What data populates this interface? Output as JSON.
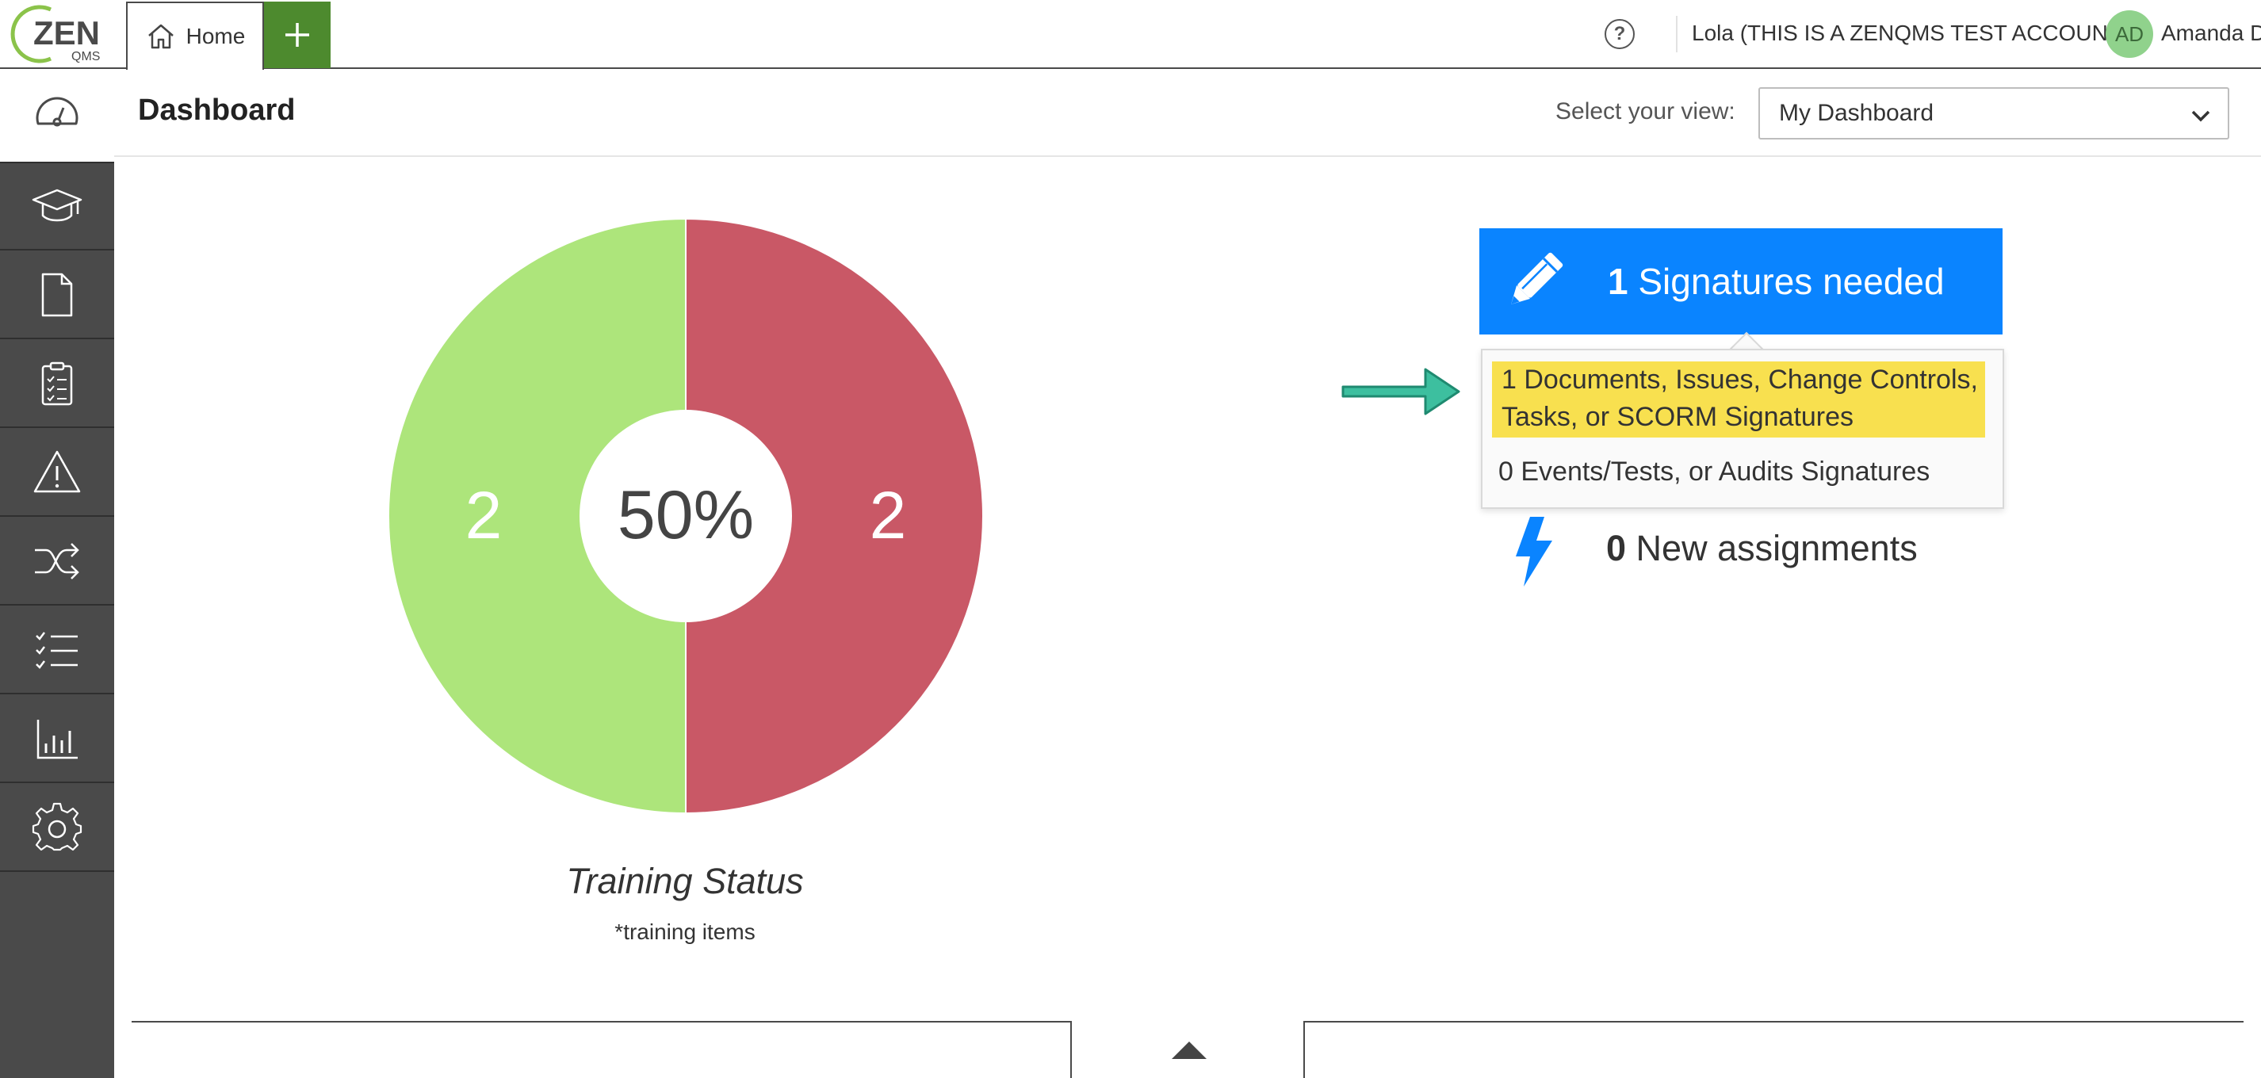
{
  "app": {
    "logo_text": "ZEN",
    "logo_sub": "QMS",
    "brand_green": "#4d8a2e",
    "brand_blue": "#0a84ff"
  },
  "tabs": {
    "home_label": "Home",
    "add_tab_icon": "plus-icon"
  },
  "topbar": {
    "help_icon": "question-circle-icon",
    "help_glyph": "?",
    "account_label": "Lola (THIS IS A ZENQMS TEST ACCOUNT)",
    "avatar_initials": "AD",
    "user_name": "Amanda D"
  },
  "sidebar": {
    "items": [
      {
        "icon": "dashboard-gauge-icon"
      },
      {
        "icon": "graduation-cap-icon"
      },
      {
        "icon": "document-icon"
      },
      {
        "icon": "clipboard-checklist-icon"
      },
      {
        "icon": "warning-triangle-icon"
      },
      {
        "icon": "shuffle-icon"
      },
      {
        "icon": "checklist-icon"
      },
      {
        "icon": "bar-chart-icon"
      },
      {
        "icon": "gear-icon"
      }
    ]
  },
  "header": {
    "title": "Dashboard",
    "view_label": "Select your view:",
    "view_value": "My Dashboard"
  },
  "chart_data": {
    "type": "pie",
    "title": "Training Status",
    "subtitle": "*training items",
    "center_label": "50%",
    "slices": [
      {
        "value": 2,
        "color": "#ade57b"
      },
      {
        "value": 2,
        "color": "#c95866"
      }
    ]
  },
  "signatures": {
    "count": "1",
    "label": "Signatures needed",
    "rows": [
      "1 Documents, Issues, Change Controls, Tasks, or SCORM Signatures",
      "0 Events/Tests, or Audits Signatures"
    ],
    "highlight_color": "#f8e04f",
    "arrow_color": "#3dbf9f"
  },
  "assignments": {
    "count": "0",
    "label": "New assignments"
  }
}
